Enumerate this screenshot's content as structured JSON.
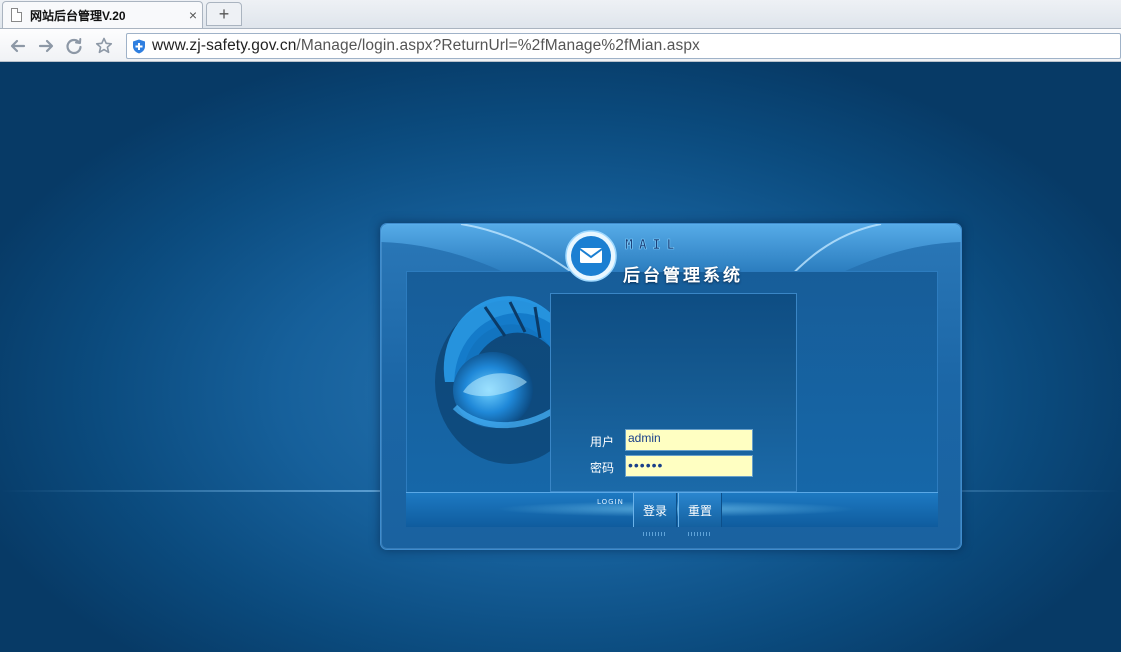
{
  "browser": {
    "tab_title": "网站后台管理V.20",
    "tab_close": "×",
    "new_tab": "+",
    "url_host": "www.zj-safety.gov.cn",
    "url_path": "/Manage/login.aspx?ReturnUrl=%2fManage%2fMian.aspx"
  },
  "panel": {
    "mail_word": "MAIL",
    "title": "后台管理系统",
    "login_small": "LOGIN"
  },
  "form": {
    "user_label": "用户",
    "user_value": "admin",
    "password_label": "密码",
    "password_value": "••••••",
    "login_button": "登录",
    "reset_button": "重置"
  },
  "colors": {
    "page_background": "#0b4a7c",
    "input_background": "#ffffc2",
    "panel_accent": "#3f8ccd"
  }
}
